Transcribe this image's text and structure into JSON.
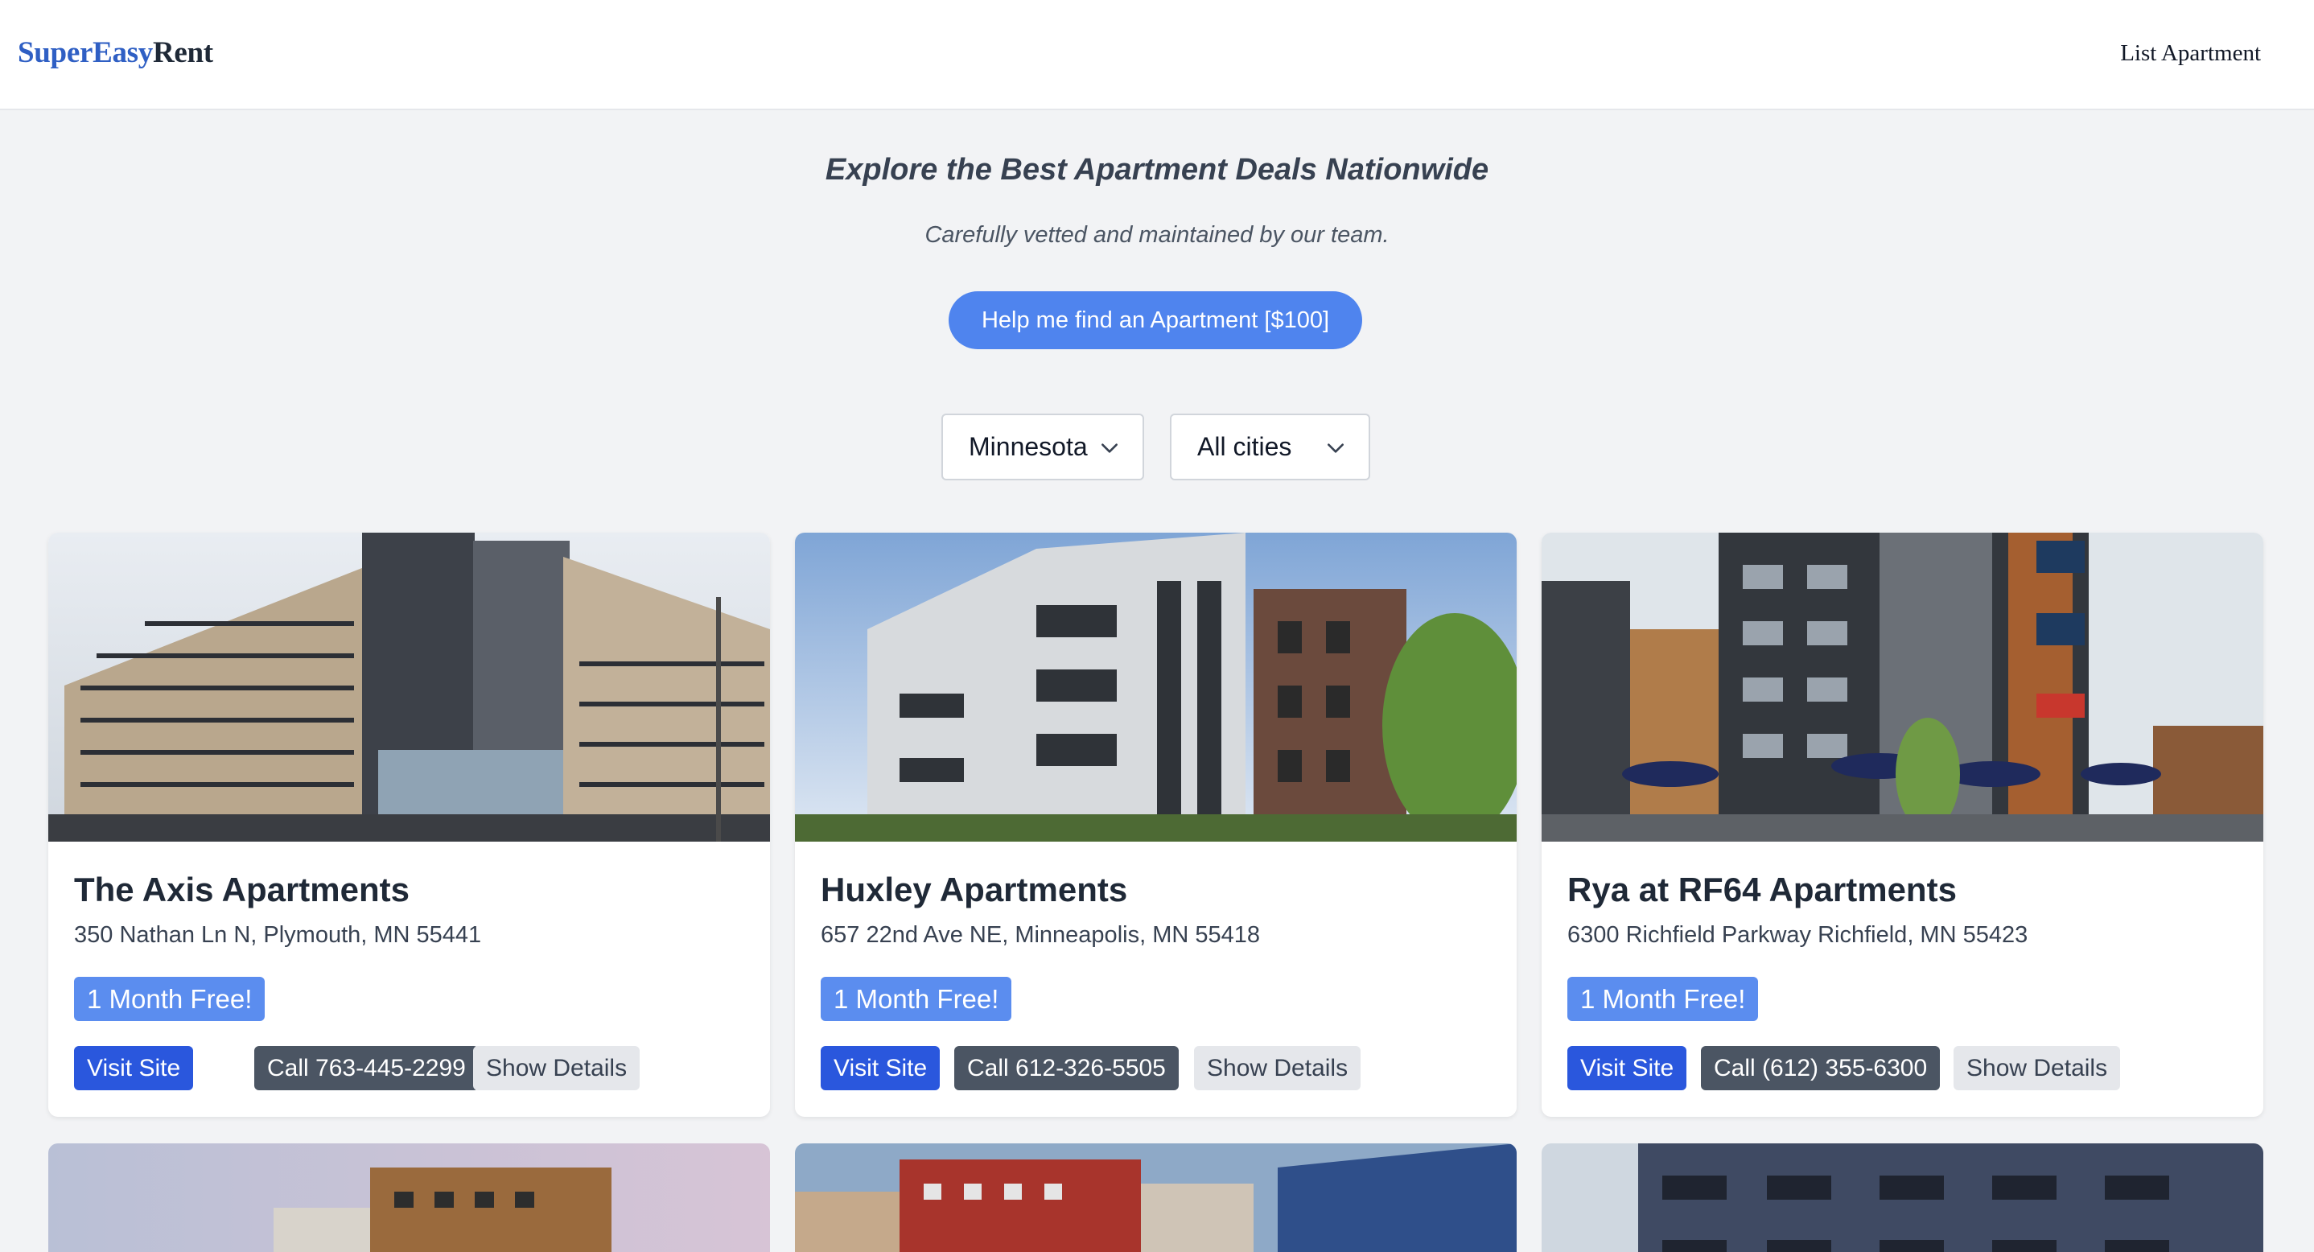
{
  "header": {
    "logo_part1": "SuperEasy",
    "logo_part2": "Rent",
    "nav_list_apartment": "List Apartment"
  },
  "hero": {
    "title": "Explore the Best Apartment Deals Nationwide",
    "subtitle": "Carefully vetted and maintained by our team.",
    "cta_label": "Help me find an Apartment [$100]"
  },
  "filters": {
    "state_selected": "Minnesota",
    "city_selected": "All cities",
    "icon": "chevron-down-icon"
  },
  "listings": [
    {
      "name": "The Axis Apartments",
      "address": "350 Nathan Ln N, Plymouth, MN 55441",
      "promo": "1 Month Free!",
      "visit_label": "Visit Site",
      "call_label": "Call 763-445-2299",
      "details_label": "Show Details"
    },
    {
      "name": "Huxley Apartments",
      "address": "657 22nd Ave NE, Minneapolis, MN 55418",
      "promo": "1 Month Free!",
      "visit_label": "Visit Site",
      "call_label": "Call 612-326-5505",
      "details_label": "Show Details"
    },
    {
      "name": "Rya at RF64 Apartments",
      "address": "6300 Richfield Parkway Richfield, MN 55423",
      "promo": "1 Month Free!",
      "visit_label": "Visit Site",
      "call_label": "Call (612) 355-6300",
      "details_label": "Show Details"
    }
  ],
  "colors": {
    "brand_blue": "#2f5fc4",
    "cta_blue": "#4f84ee",
    "promo_blue": "#5b8def",
    "visit_blue": "#2a57dd",
    "call_gray": "#4b5563",
    "details_gray": "#e5e7eb",
    "page_bg": "#f2f3f5"
  }
}
